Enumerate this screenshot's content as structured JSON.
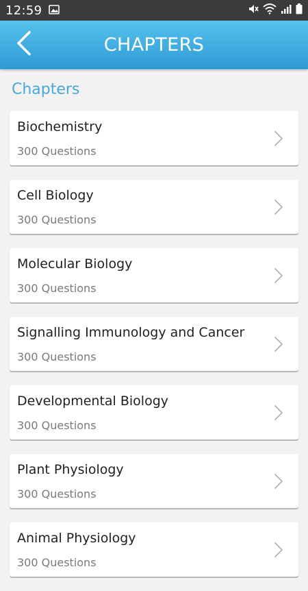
{
  "status_bar": {
    "time": "12:59",
    "left_icons": [
      "image-icon"
    ],
    "right_icons": [
      "mute-icon",
      "wifi-icon",
      "signal-icon",
      "battery-icon"
    ]
  },
  "app_bar": {
    "title": "CHAPTERS",
    "back_icon": "chevron-left-icon",
    "gradient_top": "#56c2ec",
    "gradient_bottom": "#2f9ad6"
  },
  "section": {
    "heading": "Chapters",
    "heading_color": "#47a9d8"
  },
  "chapters": [
    {
      "title": "Biochemistry",
      "subtitle": "300 Questions"
    },
    {
      "title": "Cell Biology",
      "subtitle": "300 Questions"
    },
    {
      "title": "Molecular Biology",
      "subtitle": "300 Questions"
    },
    {
      "title": "Signalling Immunology and Cancer",
      "subtitle": "300 Questions"
    },
    {
      "title": "Developmental Biology",
      "subtitle": "300 Questions"
    },
    {
      "title": "Plant Physiology",
      "subtitle": "300 Questions"
    },
    {
      "title": "Animal Physiology",
      "subtitle": "300 Questions"
    }
  ]
}
